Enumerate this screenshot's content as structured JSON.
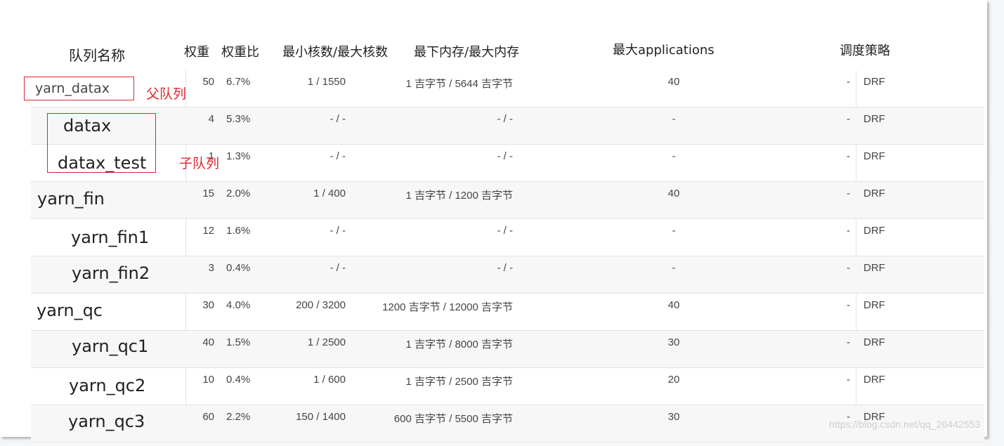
{
  "headers": {
    "name": "队列名称",
    "weight": "权重",
    "weight_ratio": "权重比",
    "cores": "最小核数/最大核数",
    "memory": "最下内存/最大内存",
    "max_apps": "最大applications",
    "policy": "调度策略"
  },
  "rows": [
    {
      "name": "yarn_datax",
      "weight": "50",
      "ratio": "6.7%",
      "cores": "1 / 1550",
      "memory": "1 吉字节 / 5644 吉字节",
      "max_apps": "40",
      "dash": "-",
      "policy": "DRF"
    },
    {
      "name": "datax",
      "weight": "4",
      "ratio": "5.3%",
      "cores": "- / -",
      "memory": "- / -",
      "max_apps": "-",
      "dash": "-",
      "policy": "DRF"
    },
    {
      "name": "datax_test",
      "weight": "1",
      "ratio": "1.3%",
      "cores": "- / -",
      "memory": "- / -",
      "max_apps": "-",
      "dash": "-",
      "policy": "DRF"
    },
    {
      "name": "yarn_fin",
      "weight": "15",
      "ratio": "2.0%",
      "cores": "1 / 400",
      "memory": "1 吉字节 / 1200 吉字节",
      "max_apps": "40",
      "dash": "-",
      "policy": "DRF"
    },
    {
      "name": "yarn_fin1",
      "weight": "12",
      "ratio": "1.6%",
      "cores": "- / -",
      "memory": "- / -",
      "max_apps": "-",
      "dash": "-",
      "policy": "DRF"
    },
    {
      "name": "yarn_fin2",
      "weight": "3",
      "ratio": "0.4%",
      "cores": "- / -",
      "memory": "- / -",
      "max_apps": "-",
      "dash": "-",
      "policy": "DRF"
    },
    {
      "name": "yarn_qc",
      "weight": "30",
      "ratio": "4.0%",
      "cores": "200 / 3200",
      "memory": "1200 吉字节 / 12000 吉字节",
      "max_apps": "40",
      "dash": "-",
      "policy": "DRF"
    },
    {
      "name": "yarn_qc1",
      "weight": "40",
      "ratio": "1.5%",
      "cores": "1 / 2500",
      "memory": "1 吉字节 / 8000 吉字节",
      "max_apps": "30",
      "dash": "-",
      "policy": "DRF"
    },
    {
      "name": "yarn_qc2",
      "weight": "10",
      "ratio": "0.4%",
      "cores": "1 / 600",
      "memory": "1 吉字节 / 2500 吉字节",
      "max_apps": "20",
      "dash": "-",
      "policy": "DRF"
    },
    {
      "name": "yarn_qc3",
      "weight": "60",
      "ratio": "2.2%",
      "cores": "150 / 1400",
      "memory": "600 吉字节 / 5500 吉字节",
      "max_apps": "30",
      "dash": "-",
      "policy": "DRF"
    }
  ],
  "annotations": {
    "parent_label": "父队列",
    "child_label": "子队列",
    "color": "#e0262d"
  },
  "watermark": "https://blog.csdn.net/qq_26442553"
}
